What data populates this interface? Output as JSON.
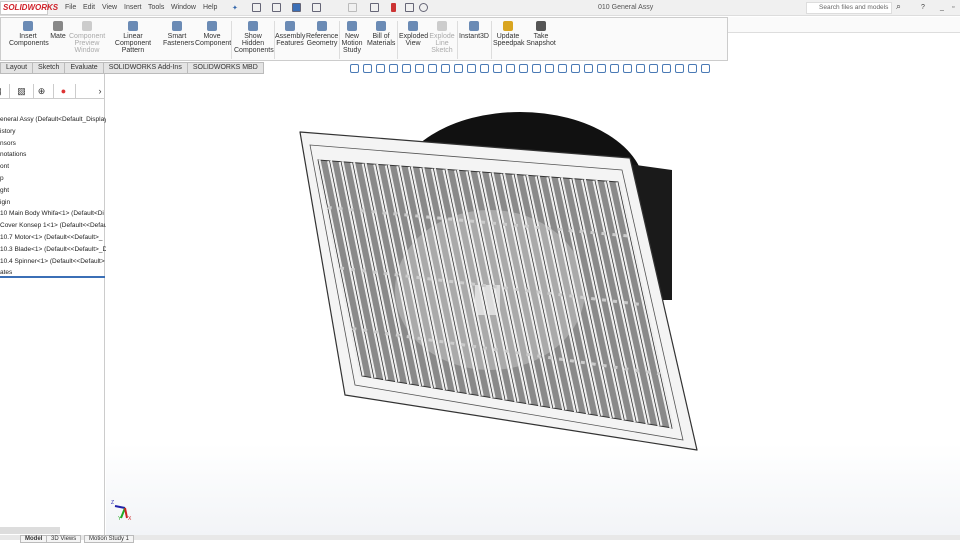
{
  "app": {
    "logo": "SOLIDWORKS",
    "document_title": "010 General Assy",
    "search_placeholder": "Search files and models"
  },
  "menu": [
    "File",
    "Edit",
    "View",
    "Insert",
    "Tools",
    "Window",
    "Help"
  ],
  "ribbon": [
    {
      "label": "Insert Components",
      "enabled": true
    },
    {
      "label": "Mate",
      "enabled": true
    },
    {
      "label": "Component Preview Window",
      "enabled": false
    },
    {
      "label": "Linear Component Pattern",
      "enabled": true
    },
    {
      "label": "Smart Fasteners",
      "enabled": true
    },
    {
      "label": "Move Component",
      "enabled": true
    },
    {
      "label": "Show Hidden Components",
      "enabled": true
    },
    {
      "label": "Assembly Features",
      "enabled": true
    },
    {
      "label": "Reference Geometry",
      "enabled": true
    },
    {
      "label": "New Motion Study",
      "enabled": true
    },
    {
      "label": "Bill of Materials",
      "enabled": true
    },
    {
      "label": "Exploded View",
      "enabled": true
    },
    {
      "label": "Explode Line Sketch",
      "enabled": false
    },
    {
      "label": "Instant3D",
      "enabled": true
    },
    {
      "label": "Update Speedpak",
      "enabled": true
    },
    {
      "label": "Take Snapshot",
      "enabled": true
    }
  ],
  "tabs": [
    "Layout",
    "Sketch",
    "Evaluate",
    "SOLIDWORKS Add-Ins",
    "SOLIDWORKS MBD"
  ],
  "tree": [
    "eneral Assy  (Default<Default_Display S",
    "istory",
    "nsors",
    "notations",
    "ont",
    "p",
    "ght",
    "igin",
    "10 Main Body Whifa<1> (Default<Di",
    "Cover Konsep 1<1> (Default<<Defau",
    "10.7 Motor<1> (Default<<Default>_",
    "10.3 Blade<1> (Default<<Default>_D",
    "10.4 Spinner<1> (Default<<Default>",
    "ates"
  ],
  "bottom_tabs": [
    "Model",
    "3D Views",
    "Motion Study 1"
  ],
  "triad": {
    "x": "X",
    "y": "Y",
    "z": "Z"
  }
}
